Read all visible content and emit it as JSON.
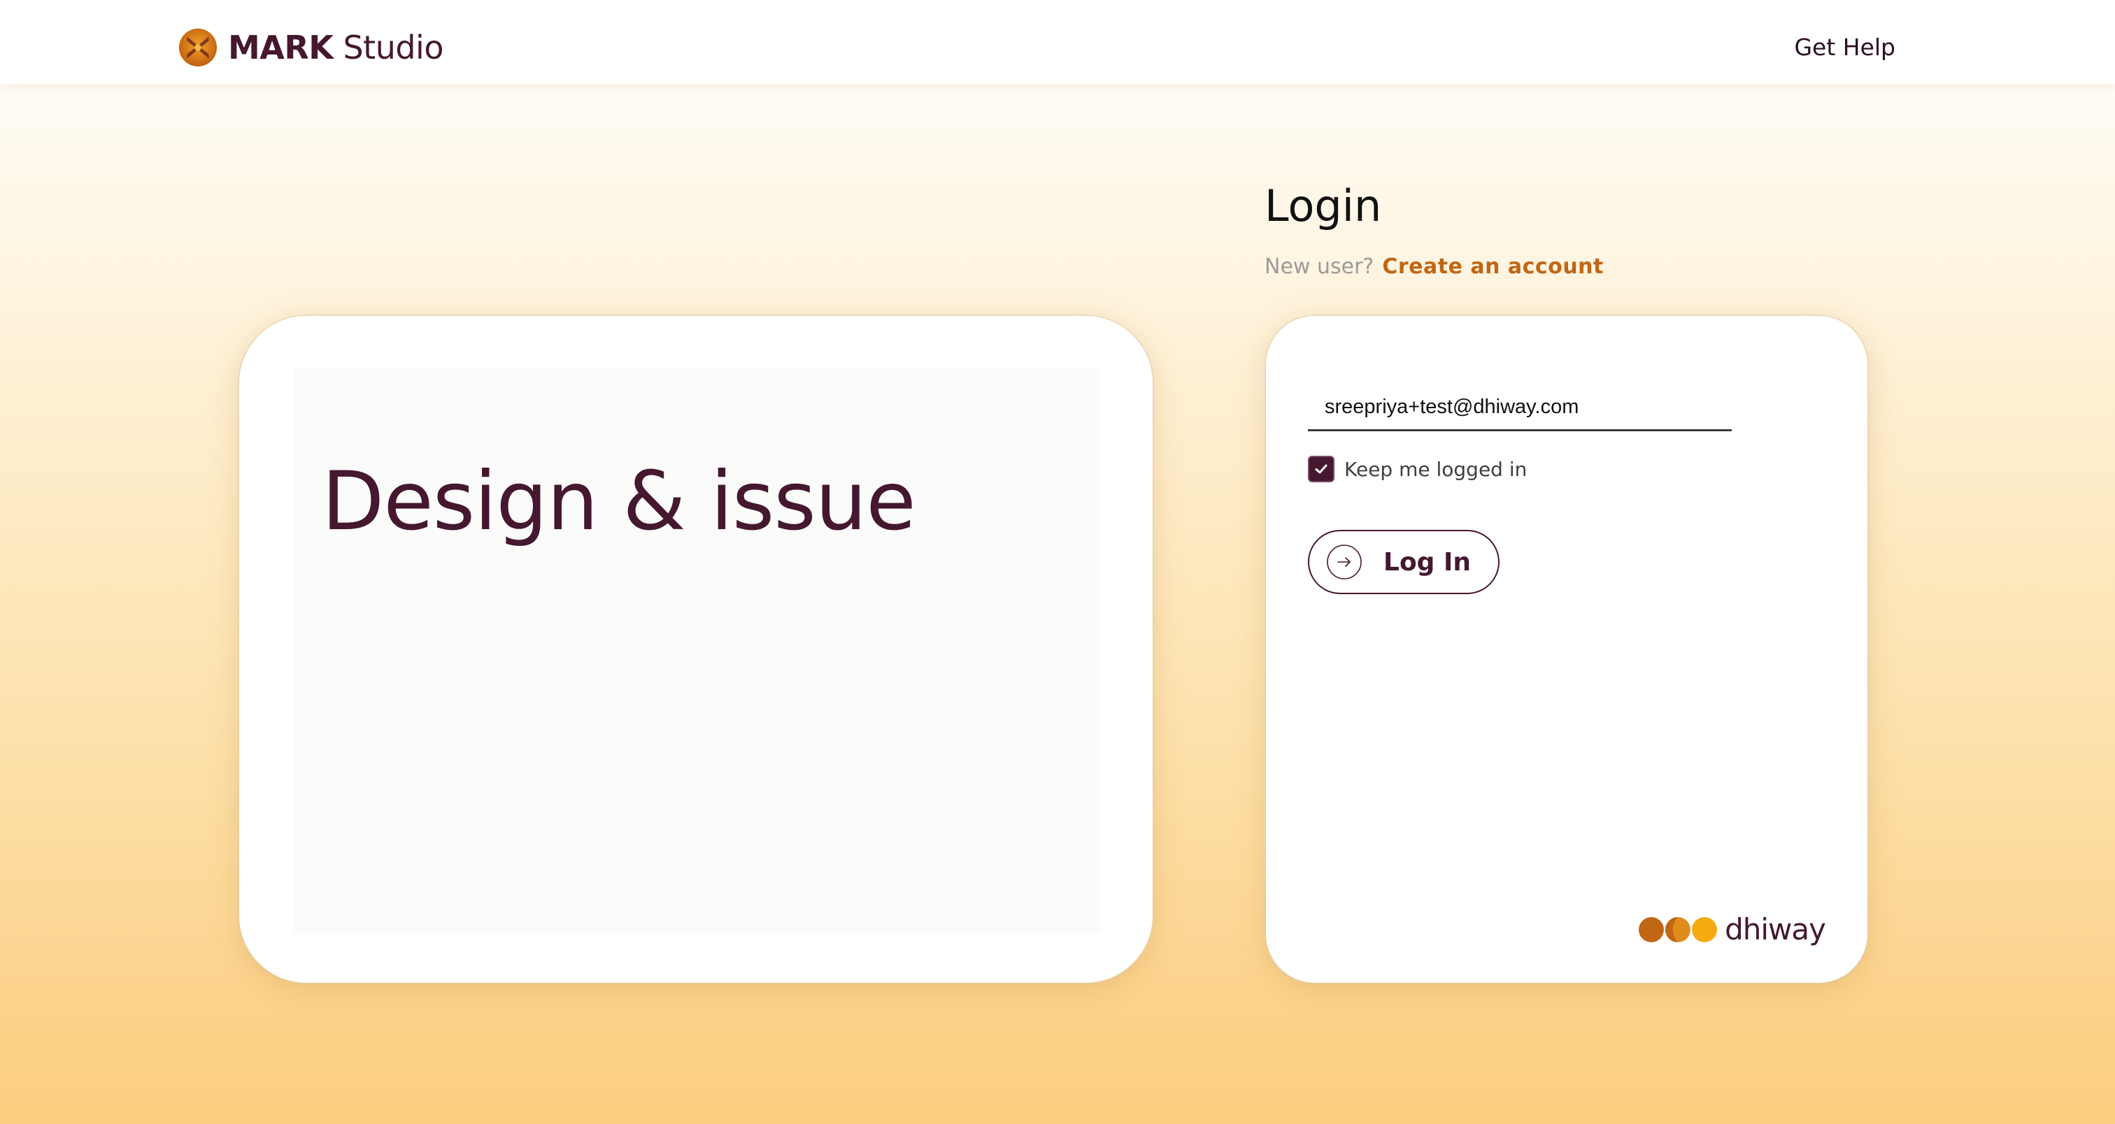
{
  "header": {
    "brand_strong": "MARK",
    "brand_light": "Studio",
    "get_help": "Get Help",
    "logo_icon": "mark-studio-logo-icon"
  },
  "hero": {
    "title": "Design & issue"
  },
  "login": {
    "title": "Login",
    "new_user_prompt": "New user?",
    "create_account": "Create an account",
    "email_value": "sreepriya+test@dhiway.com",
    "keep_logged_in_label": "Keep me logged in",
    "keep_logged_in_checked": true,
    "submit_label": "Log In",
    "submit_icon": "arrow-right-circle-icon"
  },
  "footer_brand": {
    "name": "dhiway",
    "logo_icon": "dhiway-dots-logo-icon"
  },
  "colors": {
    "brand_primary": "#45182f",
    "accent": "#c06614",
    "background_top": "#fffcf6",
    "background_bottom": "#fccd7f",
    "dhiway_orange": "#c06614",
    "dhiway_yellow": "#f6aa12"
  }
}
